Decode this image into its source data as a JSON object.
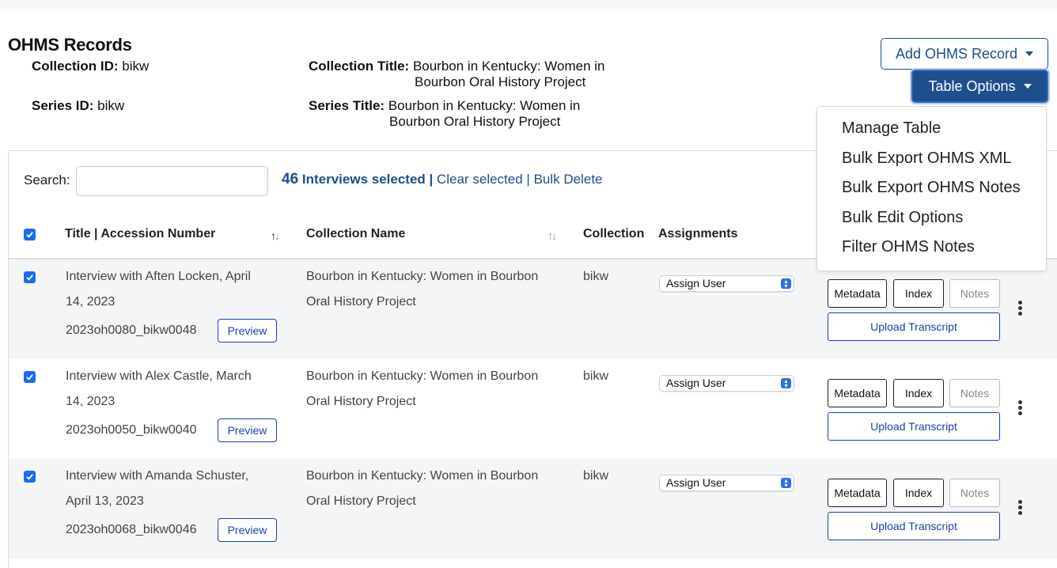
{
  "page": {
    "title": "OHMS Records"
  },
  "meta": {
    "collection_id_label": "Collection ID:",
    "collection_id": "bikw",
    "series_id_label": "Series ID:",
    "series_id": "bikw",
    "collection_title_label": "Collection Title:",
    "collection_title_line1": "Bourbon in Kentucky: Women in",
    "collection_title_line2": "Bourbon Oral History Project",
    "series_title_label": "Series Title:",
    "series_title_line1": "Bourbon in Kentucky: Women in",
    "series_title_line2": "Bourbon Oral History Project"
  },
  "buttons": {
    "add_record": "Add OHMS Record",
    "table_options": "Table Options"
  },
  "dropdown": {
    "items": [
      "Manage Table",
      "Bulk Export OHMS XML",
      "Bulk Export OHMS Notes",
      "Bulk Edit Options",
      "Filter OHMS Notes"
    ]
  },
  "toolbar": {
    "search_label": "Search:",
    "search_value": "",
    "selected_count": "46",
    "selected_text": "Interviews selected |",
    "clear_selected": "Clear selected",
    "separator": "|",
    "bulk_delete": "Bulk Delete"
  },
  "table": {
    "columns": [
      "Title | Accession Number",
      "Collection Name",
      "Collection",
      "Assignments"
    ],
    "rows": [
      {
        "checked": true,
        "title_line1": "Interview with Aften Locken, April",
        "title_line2": "14, 2023",
        "accession": "2023oh0080_bikw0048",
        "collection_name_line1": "Bourbon in Kentucky: Women in Bourbon",
        "collection_name_line2": "Oral History Project",
        "collection": "bikw",
        "assign": "Assign User"
      },
      {
        "checked": true,
        "title_line1": "Interview with Alex Castle, March",
        "title_line2": "14, 2023",
        "accession": "2023oh0050_bikw0040",
        "collection_name_line1": "Bourbon in Kentucky: Women in Bourbon",
        "collection_name_line2": "Oral History Project",
        "collection": "bikw",
        "assign": "Assign User"
      },
      {
        "checked": true,
        "title_line1": "Interview with Amanda Schuster,",
        "title_line2": "April 13, 2023",
        "accession": "2023oh0068_bikw0046",
        "collection_name_line1": "Bourbon in Kentucky: Women in Bourbon",
        "collection_name_line2": "Oral History Project",
        "collection": "bikw",
        "assign": "Assign User"
      }
    ],
    "row_buttons": {
      "preview": "Preview",
      "metadata": "Metadata",
      "index": "Index",
      "notes": "Notes",
      "upload": "Upload Transcript"
    }
  },
  "icons": {
    "sort": "sort-arrows-icon",
    "checkbox": "check-icon",
    "select": "select-arrows-icon",
    "more": "kebab-menu-icon",
    "caret": "caret-down-icon"
  },
  "colors": {
    "primary": "#1f4e8c",
    "link": "#1a3fb0",
    "checkbox": "#1a6cf0",
    "row_shade": "#f4f5f7"
  }
}
